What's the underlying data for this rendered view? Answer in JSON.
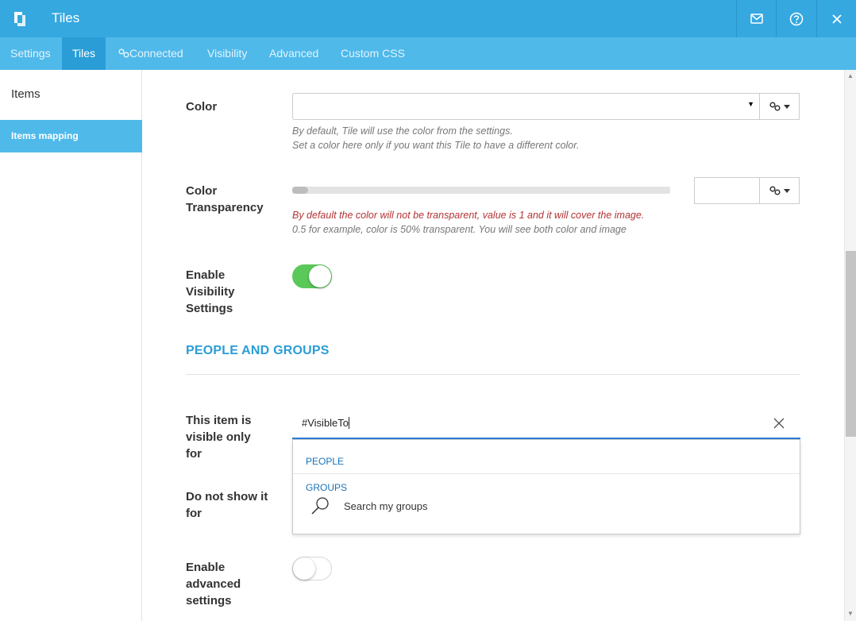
{
  "app": {
    "title": "Tiles"
  },
  "topbar": {
    "icons": [
      "logo-icon",
      "mail-icon",
      "help-icon",
      "close-icon"
    ]
  },
  "tabs": [
    {
      "label": "Settings"
    },
    {
      "label": "Tiles"
    },
    {
      "label": "Connected",
      "icon": "link-icon"
    },
    {
      "label": "Visibility"
    },
    {
      "label": "Advanced"
    },
    {
      "label": "Custom CSS"
    }
  ],
  "sidebar": {
    "items": [
      {
        "label": "Items"
      },
      {
        "label": "Items mapping"
      }
    ]
  },
  "form": {
    "color": {
      "label": "Color",
      "value": "",
      "help1": "By default, Tile will use the color from the settings.",
      "help2": "Set a color here only if you want this Tile to have a different color."
    },
    "transparency": {
      "label_line1": "Color",
      "label_line2": "Transparency",
      "value": "",
      "level": 0,
      "help_red": "By default the color will not be transparent, value is 1 and it will cover the image.",
      "help2": "0.5 for example, color is 50% transparent. You will see both color and image"
    },
    "visibility": {
      "label_line1": "Enable",
      "label_line2": "Visibility",
      "label_line3": "Settings",
      "enabled": true
    },
    "section_title": "PEOPLE AND GROUPS",
    "visible_for": {
      "label_line1": "This item is",
      "label_line2": "visible only",
      "label_line3": "for",
      "value": "#VisibleTo"
    },
    "dropdown": {
      "people_header": "PEOPLE",
      "groups_header": "GROUPS",
      "search_label": "Search my groups"
    },
    "not_show": {
      "label_line1": "Do not show it",
      "label_line2": "for"
    },
    "advanced": {
      "label_line1": "Enable",
      "label_line2": "advanced",
      "label_line3": "settings",
      "enabled": false
    }
  },
  "colors": {
    "brand": "#35a8e0",
    "tab_bar": "#4fb9ea",
    "active_tab": "#2a9dd6",
    "toggle_on": "#5ac95a",
    "section": "#2a9dd6",
    "error_text": "#b53333"
  }
}
